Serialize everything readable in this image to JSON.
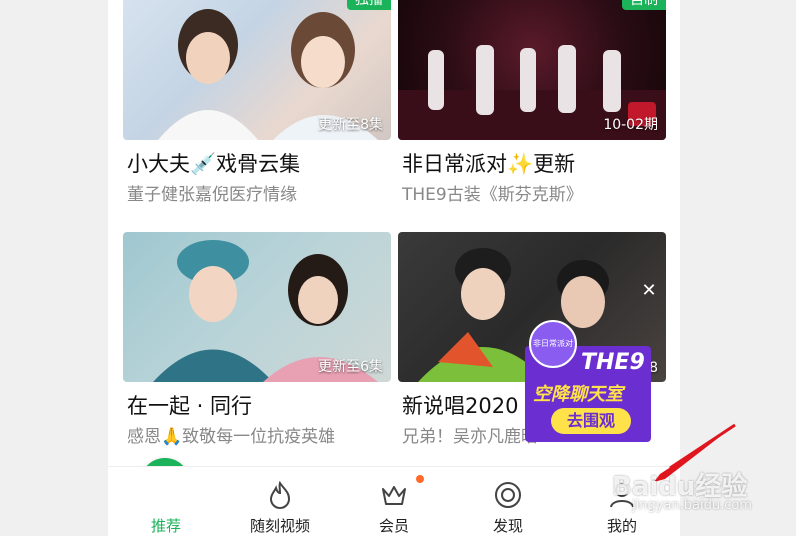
{
  "cards": [
    {
      "title": "小大夫💉戏骨云集",
      "subtitle": "董子健张嘉倪医疗情缘",
      "tag": "独播",
      "episode": "更新至8集"
    },
    {
      "title": "非日常派对✨更新",
      "subtitle": "THE9古装《斯芬克斯》",
      "tag": "自制",
      "episode": "10-02期"
    },
    {
      "title": "在一起 · 同行",
      "subtitle": "感恩🙏致敬每一位抗疫英雄",
      "tag": "",
      "episode": "更新至6集"
    },
    {
      "title": "新说唱2020",
      "subtitle": "兄弟！吴亦凡鹿晗",
      "tag": "",
      "episode": "8"
    }
  ],
  "ad": {
    "line1": "THE9",
    "line2": "空降聊天室",
    "button": "去围观",
    "badge": "非日常派对"
  },
  "tabs": [
    {
      "label": "推荐",
      "icon": "home-icon",
      "active": true
    },
    {
      "label": "随刻视频",
      "icon": "flame-icon"
    },
    {
      "label": "会员",
      "icon": "crown-icon",
      "dot": true
    },
    {
      "label": "发现",
      "icon": "discover-icon"
    },
    {
      "label": "我的",
      "icon": "profile-icon"
    }
  ],
  "watermark": {
    "brand": "Baidu经验",
    "url": "jingyan.baidu.com"
  },
  "colors": {
    "accent": "#1bb35a",
    "notification": "#ff6a2b",
    "ad_purple": "#6b2fd1"
  }
}
